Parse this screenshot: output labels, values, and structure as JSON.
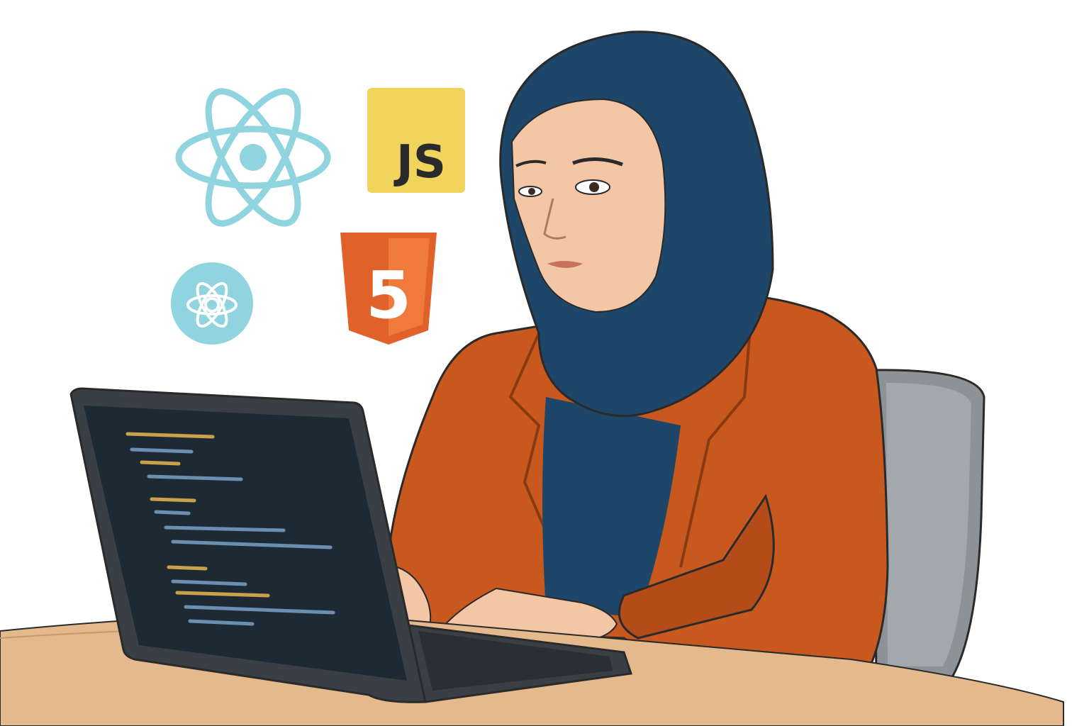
{
  "logos": {
    "react": {
      "icon": "react-atom-icon",
      "color": "#8fd4de"
    },
    "javascript": {
      "icon": "javascript-logo-icon",
      "label": "JS",
      "bg": "#f0d45c",
      "fg": "#2a2a2a"
    },
    "html5": {
      "icon": "html5-shield-icon",
      "label": "5",
      "bg": "#e0612a",
      "fg": "#ffffff"
    },
    "react_badge": {
      "icon": "react-badge-icon",
      "bg": "#8fd4de",
      "fg": "#ffffff"
    }
  },
  "colors": {
    "hijab": "#1d4668",
    "blazer": "#c9581f",
    "skin": "#f3c6a6",
    "chair": "#8d9296",
    "desk": "#e3b98d",
    "laptop": "#3a3f45",
    "screen": "#1e2a33",
    "code_yellow": "#c9a24a",
    "code_blue": "#6a8fb0"
  }
}
